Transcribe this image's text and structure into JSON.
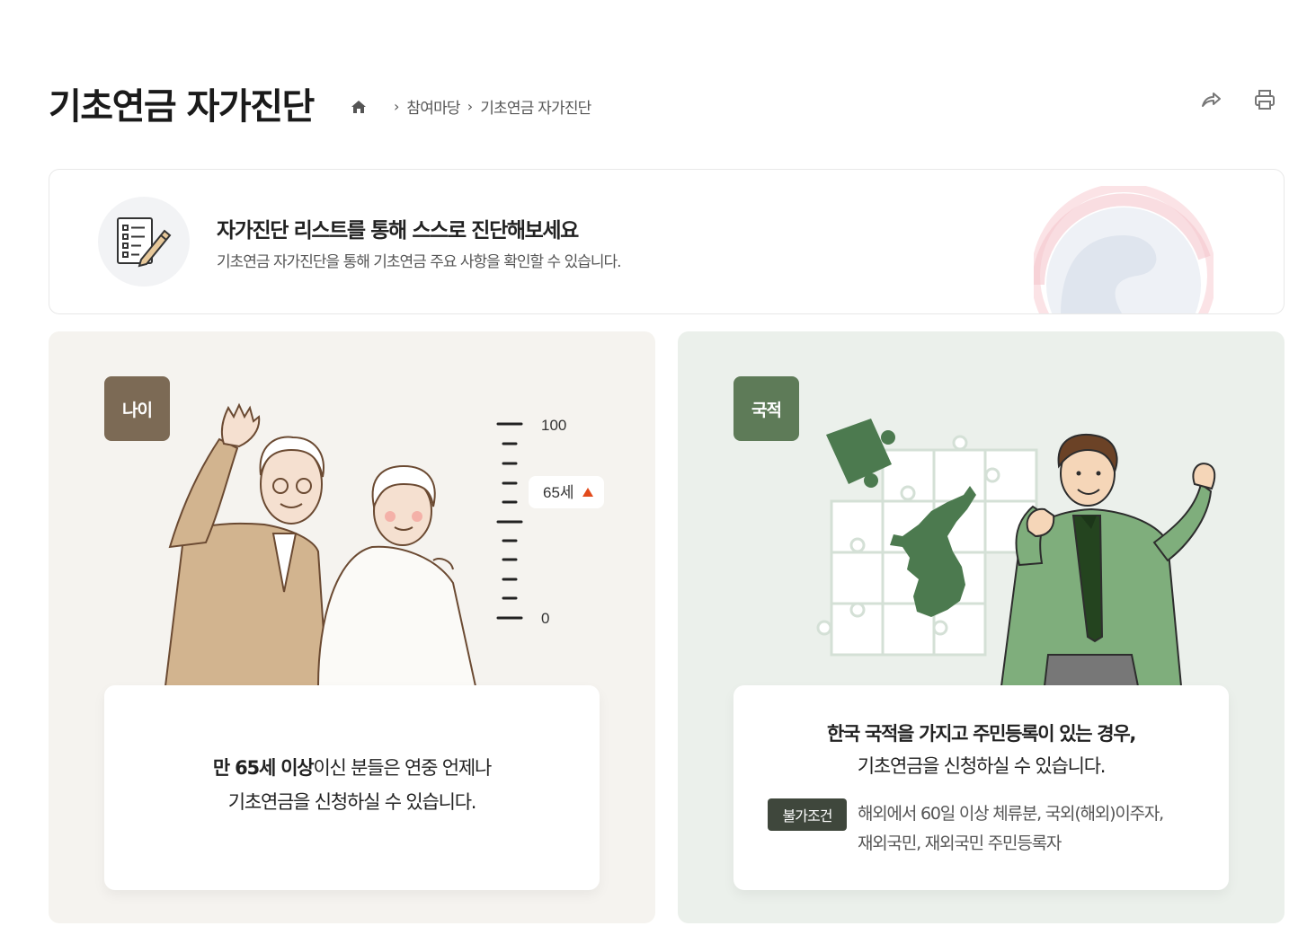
{
  "header": {
    "title": "기초연금 자가진단",
    "breadcrumb": [
      "참여마당",
      "기초연금 자가진단"
    ],
    "home_icon": "home-icon",
    "actions": [
      "share-icon",
      "print-icon"
    ]
  },
  "intro": {
    "icon": "checklist-pencil-icon",
    "headline": "자가진단 리스트를 통해 스스로 진단해보세요",
    "subtext": "기초연금 자가진단을 통해 기초연금 주요 사항을 확인할 수 있습니다."
  },
  "age_card": {
    "badge": "나이",
    "scale_max": "100",
    "scale_min": "0",
    "marker": "65세",
    "text_bold": "만 65세 이상",
    "text_rest": "이신 분들은 연중 언제나",
    "text_line2": "기초연금을 신청하실 수 있습니다.",
    "bg_color": "#f5f3ef"
  },
  "nationality_card": {
    "badge": "국적",
    "heading": "한국 국적을 가지고 주민등록이 있는 경우,",
    "subheading": "기초연금을 신청하실 수 있습니다.",
    "condition_tag": "불가조건",
    "condition_line1": "해외에서 60일 이상 체류분, 국외(해외)이주자,",
    "condition_line2": "재외국민, 재외국민 주민등록자",
    "bg_color": "#ebf0eb"
  },
  "colors": {
    "accent_age": "#7c6a55",
    "accent_nat": "#5e7b58",
    "marker_arrow": "#e24a1b"
  }
}
